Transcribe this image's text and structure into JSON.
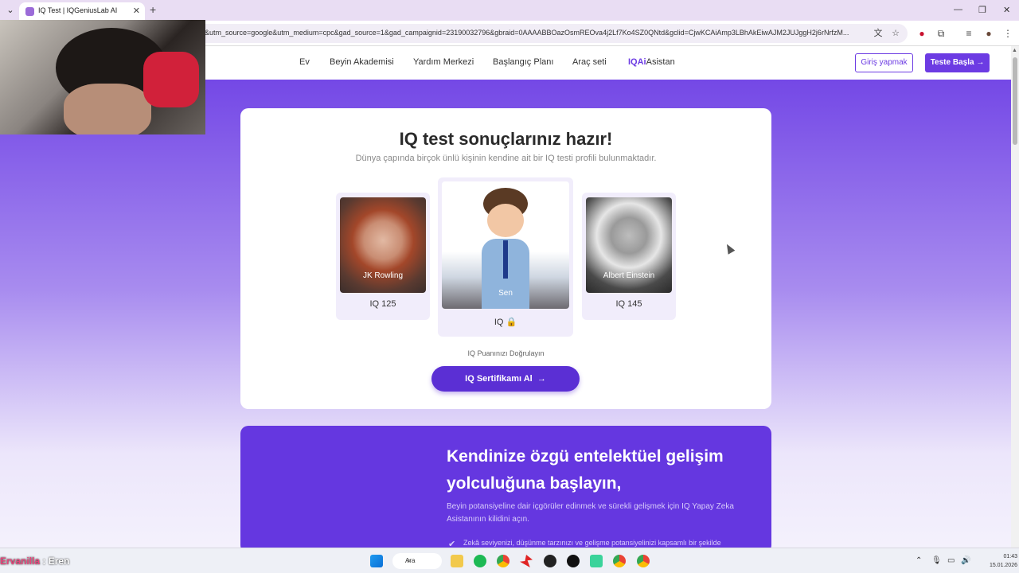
{
  "browser": {
    "tab_title": "IQ Test | IQGeniusLab AI",
    "url": "&utm_source=google&utm_medium=cpc&gad_source=1&gad_campaignid=23190032796&gbraid=0AAAABBOazOsmREOva4j2Lf7Ko4SZ0QNtd&gclid=CjwKCAiAmp3LBhAkEiwAJM2JUJggH2j6rNrfzM..."
  },
  "nav": {
    "items": [
      "Ev",
      "Beyin Akademisi",
      "Yardım Merkezi",
      "Başlangıç Planı",
      "Araç seti"
    ],
    "brand_mark": "IQAi",
    "brand_text": "Asistan",
    "login_label": "Giriş yapmak",
    "start_label": "Teste Başla",
    "start_arrow": "→"
  },
  "results": {
    "title": "IQ test sonuçlarınız hazır!",
    "subtitle": "Dünya çapında birçok ünlü kişinin kendine ait bir IQ testi profili bulunmaktadır.",
    "people": [
      {
        "name": "JK Rowling",
        "iq": "IQ 125"
      },
      {
        "name": "Sen",
        "iq": "IQ 🔒"
      },
      {
        "name": "Albert Einstein",
        "iq": "IQ 145"
      }
    ],
    "verify_text": "IQ Puanınızı Doğrulayın",
    "cert_button": "IQ Sertifikamı Al",
    "cert_arrow": "→"
  },
  "promo": {
    "title": "Kendinize özgü entelektüel gelişim yolculuğuna başlayın,",
    "description": "Beyin potansiyeline dair içgörüler edinmek ve sürekli gelişmek için IQ Yapay Zeka Asistanının kilidini açın.",
    "bullet": "Zekâ seviyenizi, düşünme tarzınızı ve gelişme potansiyelinizi kapsamlı bir şekilde"
  },
  "taskbar": {
    "stream_name": "Ervanilla",
    "stream_sep": " : ",
    "stream_user": "Eren",
    "search_label": "Ara",
    "time": "01:43",
    "date": "15.01.2026"
  },
  "colors": {
    "accent": "#6c3be3",
    "page_gradient_top": "#7448e6"
  }
}
